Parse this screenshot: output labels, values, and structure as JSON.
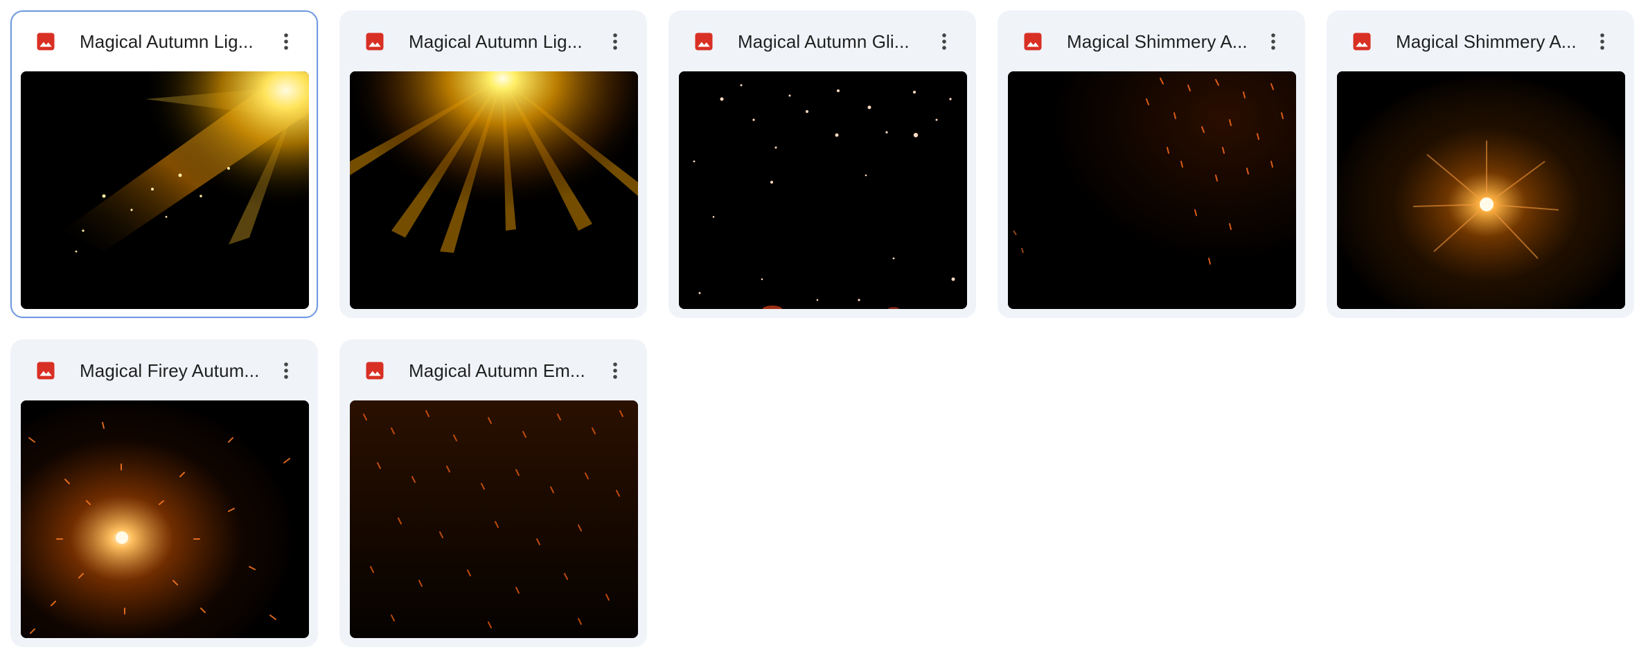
{
  "files": [
    {
      "name": "Magical Autumn Lig...",
      "selected": true,
      "thumbnail": "light-streak-corner"
    },
    {
      "name": "Magical Autumn Lig...",
      "selected": false,
      "thumbnail": "sunburst-top"
    },
    {
      "name": "Magical Autumn Gli...",
      "selected": false,
      "thumbnail": "glitter-dots"
    },
    {
      "name": "Magical Shimmery A...",
      "selected": false,
      "thumbnail": "sparks-right"
    },
    {
      "name": "Magical Shimmery A...",
      "selected": false,
      "thumbnail": "shimmer-burst"
    },
    {
      "name": "Magical Firey Autum...",
      "selected": false,
      "thumbnail": "fire-burst"
    },
    {
      "name": "Magical Autumn Em...",
      "selected": false,
      "thumbnail": "ember-rain"
    }
  ],
  "icons": {
    "file_type": "image-file-icon",
    "more": "more-vert-icon"
  },
  "colors": {
    "image_icon_red": "#d93025",
    "card_bg": "#f0f4f9",
    "selected_border": "#6f9ae1",
    "title_text": "#1f1f1f"
  }
}
